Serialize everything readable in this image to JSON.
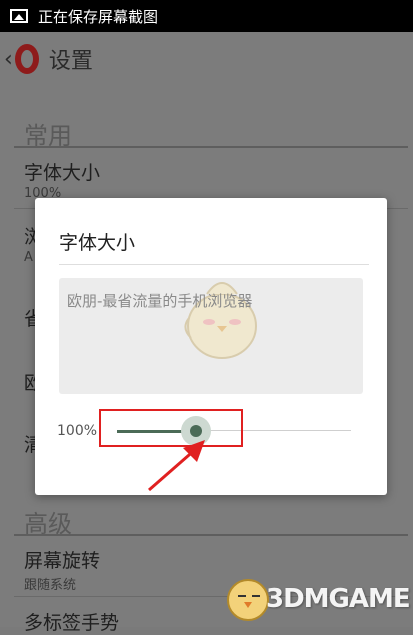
{
  "status_bar": {
    "text": "正在保存屏幕截图",
    "icon": "image-icon"
  },
  "header": {
    "title": "设置",
    "back_icon": "chevron-left-icon",
    "logo": "opera-logo"
  },
  "sections": {
    "general": {
      "heading": "常用"
    },
    "advanced": {
      "heading": "高级"
    }
  },
  "rows": {
    "font_size": {
      "title": "字体大小",
      "value": "100%"
    },
    "browser_partial": {
      "title": "浏",
      "sub": "A"
    },
    "save_partial": {
      "title": "省"
    },
    "opera_partial": {
      "title": "欧"
    },
    "clear_partial": {
      "title": "清"
    },
    "rotation": {
      "title": "屏幕旋转",
      "value": "跟随系统"
    },
    "tab_gesture": {
      "title": "多标签手势"
    }
  },
  "dialog": {
    "title": "字体大小",
    "preview_text": "欧朋-最省流量的手机浏览器",
    "zoom_label": "100%",
    "slider_value": 0.3,
    "accent": "#4b6b57"
  },
  "annotation": {
    "highlight_color": "#e02020"
  },
  "watermark": {
    "text": "3DMGAME"
  }
}
